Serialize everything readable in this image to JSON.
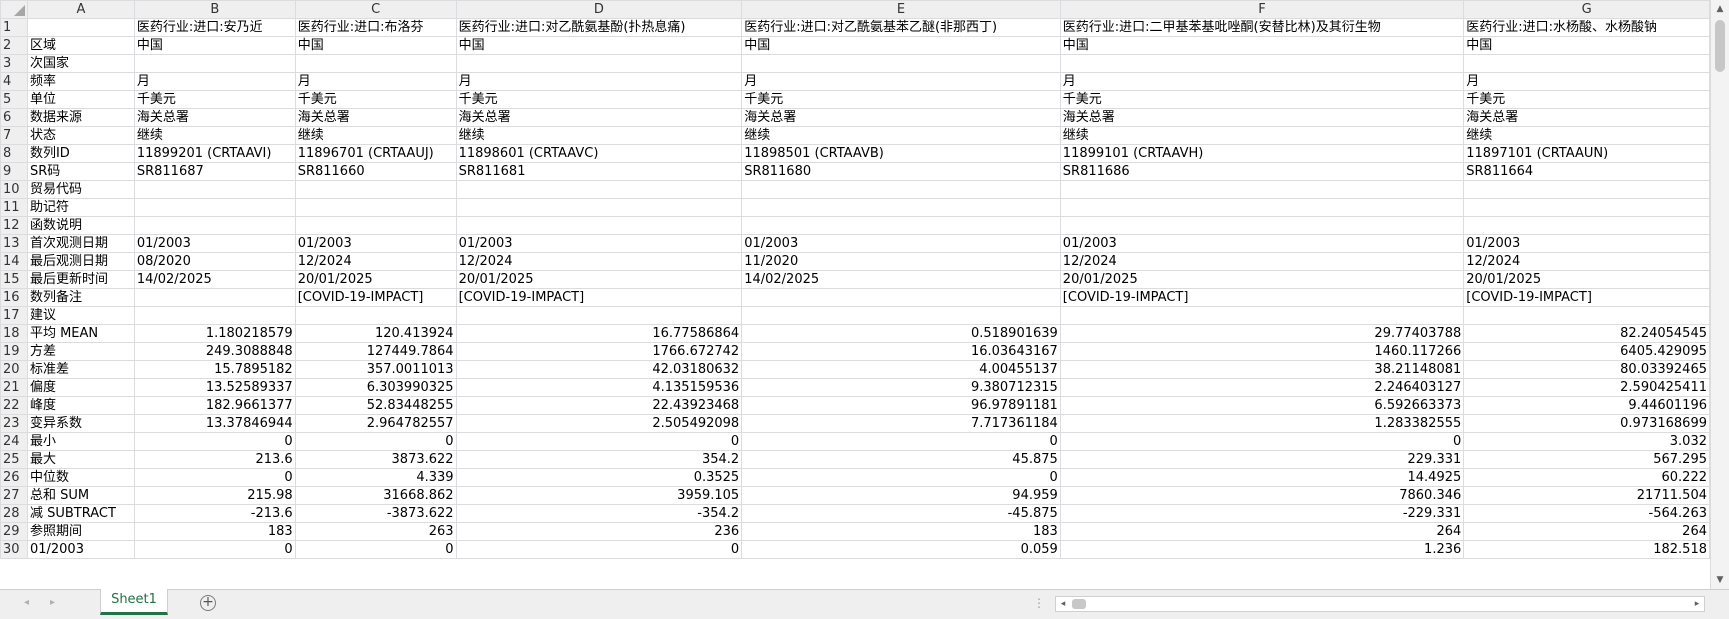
{
  "window": {
    "title": "Sheet1"
  },
  "columns": [
    "A",
    "B",
    "C",
    "D",
    "E",
    "F",
    "G"
  ],
  "header_cells": {
    "B": "医药行业:进口:安乃近",
    "C": "医药行业:进口:布洛芬",
    "D": "医药行业:进口:对乙酰氨基酚(扑热息痛)",
    "E": "医药行业:进口:对乙酰氨基苯乙醚(非那西丁)",
    "F": "医药行业:进口:二甲基苯基吡唑酮(安替比林)及其衍生物",
    "G": "医药行业:进口:水杨酸、水杨酸钠"
  },
  "rows": [
    {
      "n": "1",
      "cells": [
        "",
        "医药行业:进口:安乃近",
        "医药行业:进口:布洛芬",
        "医药行业:进口:对乙酰氨基酚(扑热息痛)",
        "医药行业:进口:对乙酰氨基苯乙醚(非那西丁)",
        "医药行业:进口:二甲基苯基吡唑酮(安替比林)及其衍生物",
        "医药行业:进口:水杨酸、水杨酸钠"
      ]
    },
    {
      "n": "2",
      "cells": [
        "区域",
        "中国",
        "中国",
        "中国",
        "中国",
        "中国",
        "中国"
      ]
    },
    {
      "n": "3",
      "cells": [
        "次国家",
        "",
        "",
        "",
        "",
        "",
        ""
      ]
    },
    {
      "n": "4",
      "cells": [
        "频率",
        "月",
        "月",
        "月",
        "月",
        "月",
        "月"
      ]
    },
    {
      "n": "5",
      "cells": [
        "单位",
        "千美元",
        "千美元",
        "千美元",
        "千美元",
        "千美元",
        "千美元"
      ]
    },
    {
      "n": "6",
      "cells": [
        "数据来源",
        "海关总署",
        "海关总署",
        "海关总署",
        "海关总署",
        "海关总署",
        "海关总署"
      ]
    },
    {
      "n": "7",
      "cells": [
        "状态",
        "继续",
        "继续",
        "继续",
        "继续",
        "继续",
        "继续"
      ]
    },
    {
      "n": "8",
      "cells": [
        "数列ID",
        "11899201 (CRTAAVI)",
        "11896701 (CRTAAUJ)",
        "11898601 (CRTAAVC)",
        "11898501 (CRTAAVB)",
        "11899101 (CRTAAVH)",
        "11897101 (CRTAAUN)"
      ]
    },
    {
      "n": "9",
      "cells": [
        "SR码",
        "SR811687",
        "SR811660",
        "SR811681",
        "SR811680",
        "SR811686",
        "SR811664"
      ]
    },
    {
      "n": "10",
      "cells": [
        "贸易代码",
        "",
        "",
        "",
        "",
        "",
        ""
      ]
    },
    {
      "n": "11",
      "cells": [
        "助记符",
        "",
        "",
        "",
        "",
        "",
        ""
      ]
    },
    {
      "n": "12",
      "cells": [
        "函数说明",
        "",
        "",
        "",
        "",
        "",
        ""
      ]
    },
    {
      "n": "13",
      "cells": [
        "首次观测日期",
        "01/2003",
        "01/2003",
        "01/2003",
        "01/2003",
        "01/2003",
        "01/2003"
      ]
    },
    {
      "n": "14",
      "cells": [
        "最后观测日期",
        "08/2020",
        "12/2024",
        "12/2024",
        "11/2020",
        "12/2024",
        "12/2024"
      ]
    },
    {
      "n": "15",
      "cells": [
        "最后更新时间",
        "14/02/2025",
        "20/01/2025",
        "20/01/2025",
        "14/02/2025",
        "20/01/2025",
        "20/01/2025"
      ]
    },
    {
      "n": "16",
      "cells": [
        "数列备注",
        "",
        "[COVID-19-IMPACT]",
        "[COVID-19-IMPACT]",
        "",
        "[COVID-19-IMPACT]",
        "[COVID-19-IMPACT]"
      ]
    },
    {
      "n": "17",
      "cells": [
        "建议",
        "",
        "",
        "",
        "",
        "",
        ""
      ]
    },
    {
      "n": "18",
      "num": true,
      "cells": [
        "平均 MEAN",
        "1.180218579",
        "120.413924",
        "16.77586864",
        "0.518901639",
        "29.77403788",
        "82.24054545"
      ]
    },
    {
      "n": "19",
      "num": true,
      "cells": [
        "方差",
        "249.3088848",
        "127449.7864",
        "1766.672742",
        "16.03643167",
        "1460.117266",
        "6405.429095"
      ]
    },
    {
      "n": "20",
      "num": true,
      "cells": [
        "标准差",
        "15.7895182",
        "357.0011013",
        "42.03180632",
        "4.00455137",
        "38.21148081",
        "80.03392465"
      ]
    },
    {
      "n": "21",
      "num": true,
      "cells": [
        "偏度",
        "13.52589337",
        "6.303990325",
        "4.135159536",
        "9.380712315",
        "2.246403127",
        "2.590425411"
      ]
    },
    {
      "n": "22",
      "num": true,
      "cells": [
        "峰度",
        "182.9661377",
        "52.83448255",
        "22.43923468",
        "96.97891181",
        "6.592663373",
        "9.44601196"
      ]
    },
    {
      "n": "23",
      "num": true,
      "cells": [
        "变异系数",
        "13.37846944",
        "2.964782557",
        "2.505492098",
        "7.717361184",
        "1.283382555",
        "0.973168699"
      ]
    },
    {
      "n": "24",
      "num": true,
      "cells": [
        "最小",
        "0",
        "0",
        "0",
        "0",
        "0",
        "3.032"
      ]
    },
    {
      "n": "25",
      "num": true,
      "cells": [
        "最大",
        "213.6",
        "3873.622",
        "354.2",
        "45.875",
        "229.331",
        "567.295"
      ]
    },
    {
      "n": "26",
      "num": true,
      "cells": [
        "中位数",
        "0",
        "4.339",
        "0.3525",
        "0",
        "14.4925",
        "60.222"
      ]
    },
    {
      "n": "27",
      "num": true,
      "cells": [
        "总和 SUM",
        "215.98",
        "31668.862",
        "3959.105",
        "94.959",
        "7860.346",
        "21711.504"
      ]
    },
    {
      "n": "28",
      "num": true,
      "cells": [
        "减 SUBTRACT",
        "-213.6",
        "-3873.622",
        "-354.2",
        "-45.875",
        "-229.331",
        "-564.263"
      ]
    },
    {
      "n": "29",
      "num": true,
      "cells": [
        "参照期间",
        "183",
        "263",
        "236",
        "183",
        "264",
        "264"
      ]
    },
    {
      "n": "30",
      "num": true,
      "cells": [
        "01/2003",
        "0",
        "0",
        "0",
        "0.059",
        "1.236",
        "182.518"
      ]
    }
  ],
  "sheet_tabs": [
    {
      "label": "Sheet1",
      "active": true
    }
  ],
  "add_sheet_label": "+",
  "icons": {
    "nav_prev": "◂",
    "nav_next": "▸",
    "scroll_up": "▲",
    "scroll_down": "▼",
    "scroll_left": "◂",
    "scroll_right": "▸",
    "split": "⋮"
  },
  "colors": {
    "accent": "#217346",
    "header_bg": "#efefef",
    "gridline": "#dadcdf"
  }
}
